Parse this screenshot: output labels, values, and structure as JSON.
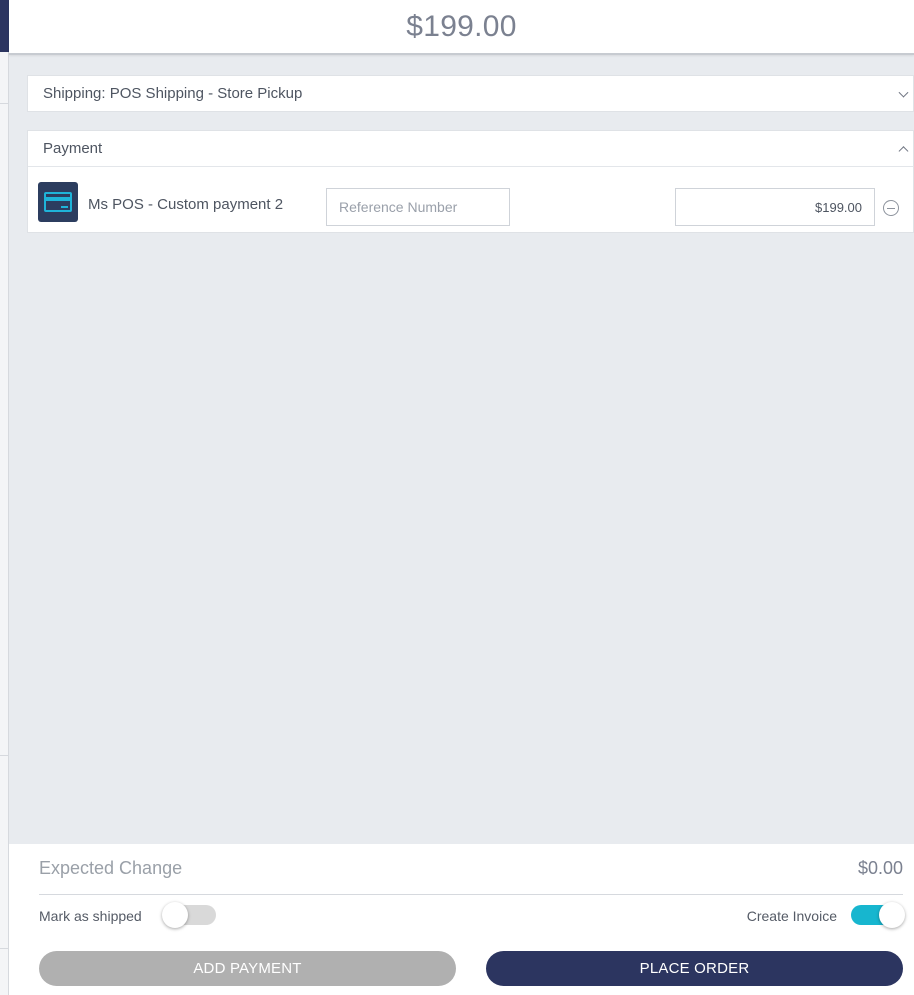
{
  "header": {
    "total": "$199.00"
  },
  "shipping": {
    "label": "Shipping: POS Shipping - Store Pickup"
  },
  "payment": {
    "title": "Payment",
    "method": {
      "name": "Ms POS - Custom payment 2",
      "icon": "credit-card-icon",
      "reference_placeholder": "Reference Number",
      "reference_value": "",
      "amount": "$199.00"
    }
  },
  "footer": {
    "expected_change_label": "Expected Change",
    "expected_change_value": "$0.00",
    "mark_as_shipped_label": "Mark as shipped",
    "mark_as_shipped_on": false,
    "create_invoice_label": "Create Invoice",
    "create_invoice_on": true,
    "add_payment_label": "ADD PAYMENT",
    "place_order_label": "PLACE ORDER"
  },
  "colors": {
    "primary": "#2c3560",
    "accent": "#17b6cf",
    "disabled_button": "#b0b0b0"
  }
}
